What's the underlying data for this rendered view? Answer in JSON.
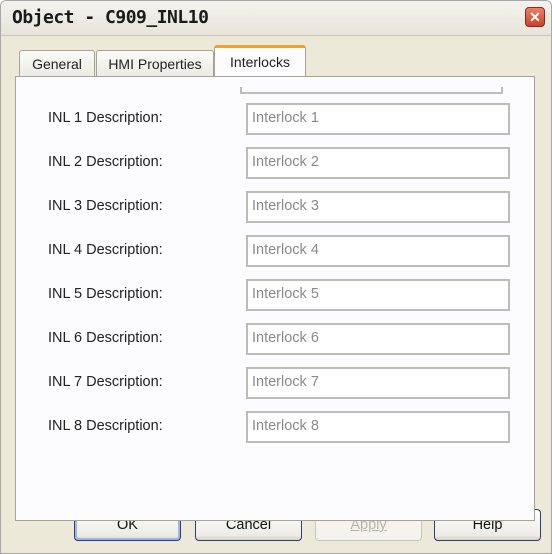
{
  "window": {
    "title": "Object - C909_INL10",
    "close_glyph": "✕"
  },
  "tabs": [
    {
      "label": "General"
    },
    {
      "label": "HMI Properties"
    },
    {
      "label": "Interlocks",
      "active": true
    }
  ],
  "interlocks": [
    {
      "label": "INL 1 Description:",
      "value": "Interlock 1"
    },
    {
      "label": "INL 2 Description:",
      "value": "Interlock 2"
    },
    {
      "label": "INL 3 Description:",
      "value": "Interlock 3"
    },
    {
      "label": "INL 4 Description:",
      "value": "Interlock 4"
    },
    {
      "label": "INL 5 Description:",
      "value": "Interlock 5"
    },
    {
      "label": "INL 6 Description:",
      "value": "Interlock 6"
    },
    {
      "label": "INL 7 Description:",
      "value": "Interlock 7"
    },
    {
      "label": "INL 8 Description:",
      "value": "Interlock 8"
    }
  ],
  "buttons": {
    "ok": "OK",
    "cancel": "Cancel",
    "apply": "Apply",
    "help": "Help"
  },
  "colors": {
    "active_tab_accent": "#f0a030",
    "close_button": "#c8432b",
    "default_button_border": "#2c3e7a"
  }
}
